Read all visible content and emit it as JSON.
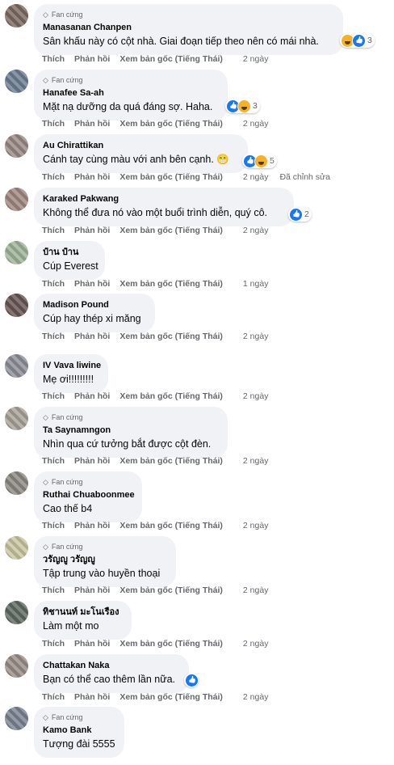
{
  "labels": {
    "like": "Thích",
    "reply": "Phản hồi",
    "translate": "Xem bản gốc (Tiếng Thái)"
  },
  "comments": [
    {
      "fan_badge": "Fan cứng",
      "name": "Manasanan Chanpen",
      "text": "Sân khấu này có cột nhà. Giai đoạn tiếp theo nên có mái nhà.",
      "time": "2 ngày",
      "reactions": [
        "haha",
        "like"
      ],
      "reaction_count": "3"
    },
    {
      "fan_badge": "Fan cứng",
      "name": "Hanafee Sa-ah",
      "text": "Mặt nạ dưỡng da quá đáng sợ. Haha.",
      "time": "2 ngày",
      "reactions": [
        "like",
        "haha"
      ],
      "reaction_count": "3"
    },
    {
      "fan_badge": "",
      "name": "Au Chirattikan",
      "text": "Cánh tay cùng màu với anh bên cạnh. 😁",
      "time": "2 ngày",
      "edited": "Đã chỉnh sửa",
      "reactions": [
        "like",
        "haha"
      ],
      "reaction_count": "5"
    },
    {
      "fan_badge": "",
      "name": "Karaked Pakwang",
      "text": "Không thể đưa nó vào một buổi trình diễn, quý cô.",
      "time": "2 ngày",
      "reactions": [
        "like"
      ],
      "reaction_count": "2"
    },
    {
      "fan_badge": "",
      "name": "ป๋าน ป๋าน",
      "text": "Cúp Everest",
      "time": "1 ngày",
      "reactions": [],
      "reaction_count": ""
    },
    {
      "fan_badge": "",
      "name": "Madison Pound",
      "text": "Cúp hay thép xi măng",
      "time": "2 ngày",
      "reactions": [],
      "reaction_count": ""
    },
    {
      "fan_badge": "",
      "name": "IV Vava liwine",
      "text": "Mẹ ơi!!!!!!!!!",
      "time": "2 ngày",
      "reactions": [],
      "reaction_count": ""
    },
    {
      "fan_badge": "Fan cứng",
      "name": "Ta Saynamngon",
      "text": "Nhìn qua cứ tưởng bắt được cột đèn.",
      "time": "2 ngày",
      "reactions": [],
      "reaction_count": ""
    },
    {
      "fan_badge": "Fan cứng",
      "name": "Ruthai Chuaboonmee",
      "text": "Cao thế b4",
      "time": "2 ngày",
      "reactions": [],
      "reaction_count": ""
    },
    {
      "fan_badge": "Fan cứng",
      "name": "วรัญญู วรัญญู",
      "text": "Tập trung vào huyền thoại",
      "time": "2 ngày",
      "reactions": [],
      "reaction_count": ""
    },
    {
      "fan_badge": "",
      "name": "ทิชานนท์ มะโนเรือง",
      "text": "Làm một mo",
      "time": "2 ngày",
      "reactions": [],
      "reaction_count": ""
    },
    {
      "fan_badge": "",
      "name": "Chattakan Naka",
      "text": "Bạn có thể cao thêm lần nữa.",
      "time": "2 ngày",
      "reactions": [
        "like"
      ],
      "reaction_count": ""
    },
    {
      "fan_badge": "Fan cứng",
      "name": "Kamo Bank",
      "text": "Tượng đài 5555",
      "time": "",
      "reactions": [],
      "reaction_count": ""
    }
  ]
}
